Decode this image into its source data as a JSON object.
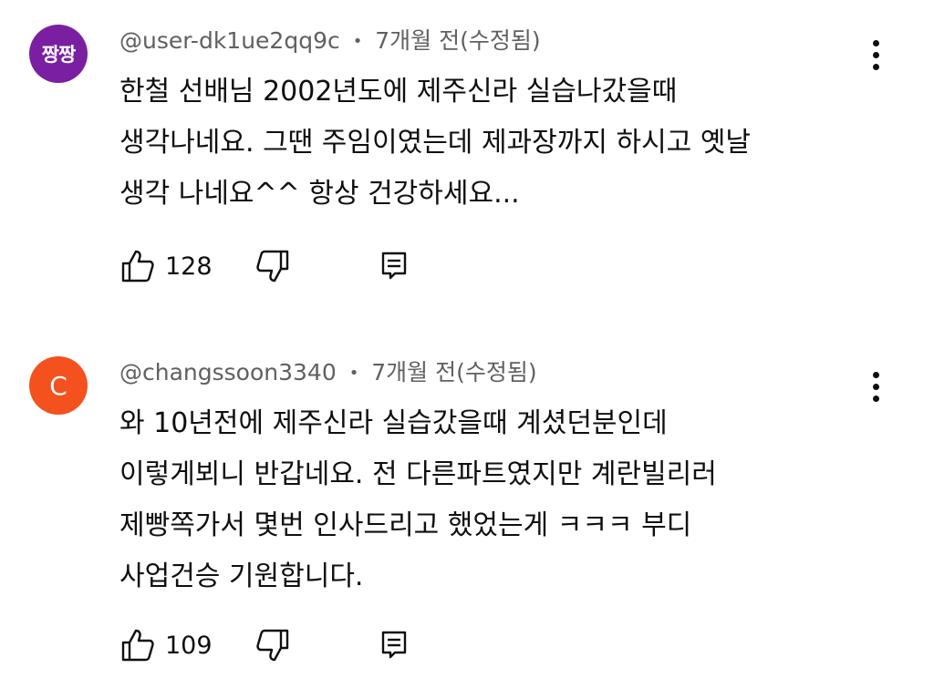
{
  "comments": [
    {
      "avatar_text": "짱짱",
      "avatar_color": "#7b1fa2",
      "username": "@user-dk1ue2qq9c",
      "separator": "•",
      "timestamp": "7개월 전(수정됨)",
      "lines": [
        "한철 선배님 2002년도에  제주신라 실습나갔을때",
        "생각나네요. 그땐 주임이였는데 제과장까지 하시고 옛날",
        "생각 나네요^^ 항상 건강하세요..."
      ],
      "like_count": "128",
      "like_icon": "thumbs-up-icon",
      "dislike_icon": "thumbs-down-icon",
      "reply_icon": "reply-icon",
      "more_icon": "more-vert-icon"
    },
    {
      "avatar_text": "C",
      "avatar_color": "#f4511e",
      "username": "@changssoon3340",
      "separator": "•",
      "timestamp": "7개월 전(수정됨)",
      "lines": [
        "와 10년전에 제주신라 실습갔을때 계셨던분인데",
        "이렇게뵈니 반갑네요. 전 다른파트였지만 계란빌리러",
        "제빵쪽가서 몇번 인사드리고 했었는게 ㅋㅋㅋ 부디",
        "사업건승 기원합니다."
      ],
      "like_count": "109",
      "like_icon": "thumbs-up-icon",
      "dislike_icon": "thumbs-down-icon",
      "reply_icon": "reply-icon",
      "more_icon": "more-vert-icon"
    }
  ]
}
